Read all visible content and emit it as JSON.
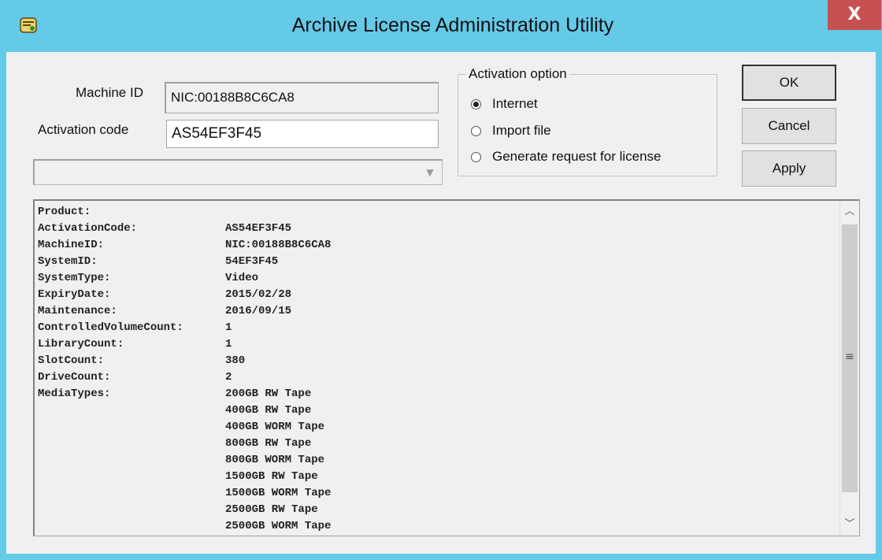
{
  "window": {
    "title": "Archive License Administration Utility",
    "close_label": "X"
  },
  "form": {
    "machine_id_label": "Machine ID",
    "machine_id_value": "NIC:00188B8C6CA8",
    "activation_code_label": "Activation code",
    "activation_code_value": "AS54EF3F45",
    "combo_value": ""
  },
  "activation_option": {
    "title": "Activation option",
    "options": [
      {
        "label": "Internet",
        "selected": true
      },
      {
        "label": "Import file",
        "selected": false
      },
      {
        "label": "Generate request for license",
        "selected": false
      }
    ]
  },
  "buttons": {
    "ok": "OK",
    "cancel": "Cancel",
    "apply": "Apply"
  },
  "license_info": {
    "lines": [
      {
        "key": "Product:",
        "value": ""
      },
      {
        "key": "ActivationCode:",
        "value": "AS54EF3F45"
      },
      {
        "key": "MachineID:",
        "value": "NIC:00188B8C6CA8"
      },
      {
        "key": "SystemID:",
        "value": "54EF3F45"
      },
      {
        "key": "SystemType:",
        "value": "Video"
      },
      {
        "key": "ExpiryDate:",
        "value": "2015/02/28"
      },
      {
        "key": "Maintenance:",
        "value": "2016/09/15"
      },
      {
        "key": "ControlledVolumeCount:",
        "value": "1"
      },
      {
        "key": "LibraryCount:",
        "value": "1"
      },
      {
        "key": "SlotCount:",
        "value": "380"
      },
      {
        "key": "DriveCount:",
        "value": "2"
      },
      {
        "key": "MediaTypes:",
        "value": "200GB RW Tape"
      },
      {
        "key": "",
        "value": "400GB RW Tape"
      },
      {
        "key": "",
        "value": "400GB WORM Tape"
      },
      {
        "key": "",
        "value": "800GB RW Tape"
      },
      {
        "key": "",
        "value": "800GB WORM Tape"
      },
      {
        "key": "",
        "value": "1500GB RW Tape"
      },
      {
        "key": "",
        "value": "1500GB WORM Tape"
      },
      {
        "key": "",
        "value": "2500GB RW Tape"
      },
      {
        "key": "",
        "value": "2500GB WORM Tape"
      }
    ]
  },
  "icons": {
    "app": "license-scroll-icon",
    "scroll_up": "chevron-up-icon",
    "scroll_down": "chevron-down-icon",
    "combo_arrow": "dropdown-arrow-icon"
  },
  "colors": {
    "titlebar": "#65c9e8",
    "close_button": "#c75050",
    "client_background": "#f0f0f0"
  }
}
